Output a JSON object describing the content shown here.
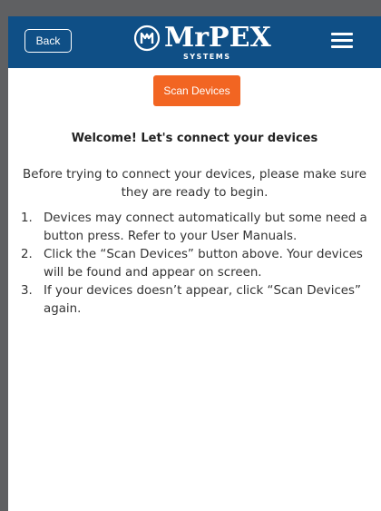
{
  "header": {
    "back_label": "Back",
    "logo_text": "MrPEX",
    "logo_sub": "SYSTEMS",
    "menu_icon": "hamburger-menu-icon",
    "bg_color": "#0f4f86"
  },
  "main": {
    "scan_button_label": "Scan Devices",
    "scan_button_color": "#f26522",
    "welcome_title": "Welcome! Let's connect your devices",
    "intro_text": "Before trying to connect your devices, please make sure they are ready to begin.",
    "steps": [
      {
        "num": "1.",
        "text": "Devices may connect automatically but some need a button press. Refer to your User Manuals."
      },
      {
        "num": "2.",
        "text": "Click the “Scan Devices” button above. Your devices will be found and appear on screen."
      },
      {
        "num": "3.",
        "text": "If your devices doesn’t appear, click “Scan Devices” again."
      }
    ]
  }
}
